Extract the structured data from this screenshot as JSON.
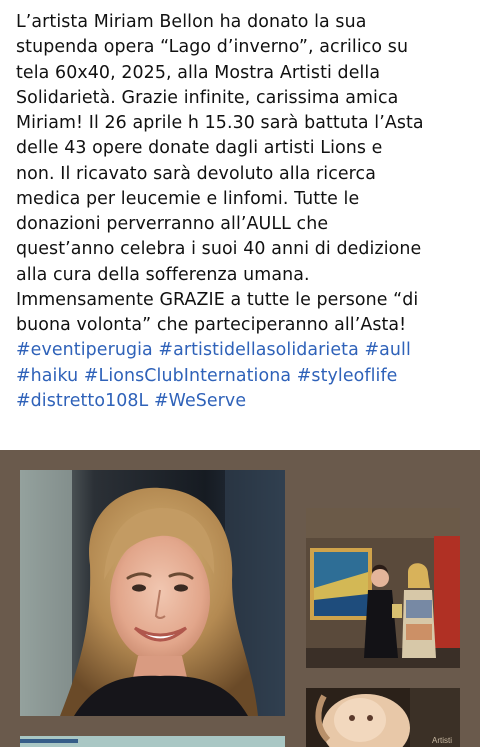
{
  "post": {
    "body_lines": [
      "L’artista Miriam Bellon ha donato la sua",
      "stupenda opera “Lago d’inverno”, acrilico su",
      "tela 60x40, 2025, alla Mostra Artisti della",
      "Solidarietà. Grazie infinite, carissima amica",
      "Miriam! Il 26 aprile h 15.30 sarà battuta l’Asta",
      "delle 43 opere donate dagli artisti Lions e",
      "non. Il ricavato sarà devoluto alla ricerca",
      "medica per leucemie e linfomi. Tutte le",
      "donazioni perverranno all’AULL che",
      "quest’anno celebra i suoi 40 anni di dedizione",
      "alla cura della sofferenza umana.",
      "Immensamente GRAZIE a tutte le persone “di",
      "buona volonta” che parteciperanno all’Asta!"
    ],
    "hashtags": {
      "eventiperugia": "#eventiperugia",
      "artistidellasolidarieta": "#artistidellasolidarieta",
      "aull": "#aull",
      "haiku": "#haiku",
      "lionsclub": "#LionsClubInternationa",
      "styleoflife": "#styleoflife",
      "distretto": "#distretto108L",
      "weserve": "#WeServe"
    }
  },
  "gallery": {
    "thumb_caption": "Artisti"
  },
  "colors": {
    "text": "#111111",
    "hashtag": "#2f62b9",
    "gallery_background": "#6a5a4c"
  },
  "icons": {
    "main_photo": "portrait-photo",
    "thumb_1": "exhibition-photo",
    "thumb_2": "painting-photo"
  }
}
